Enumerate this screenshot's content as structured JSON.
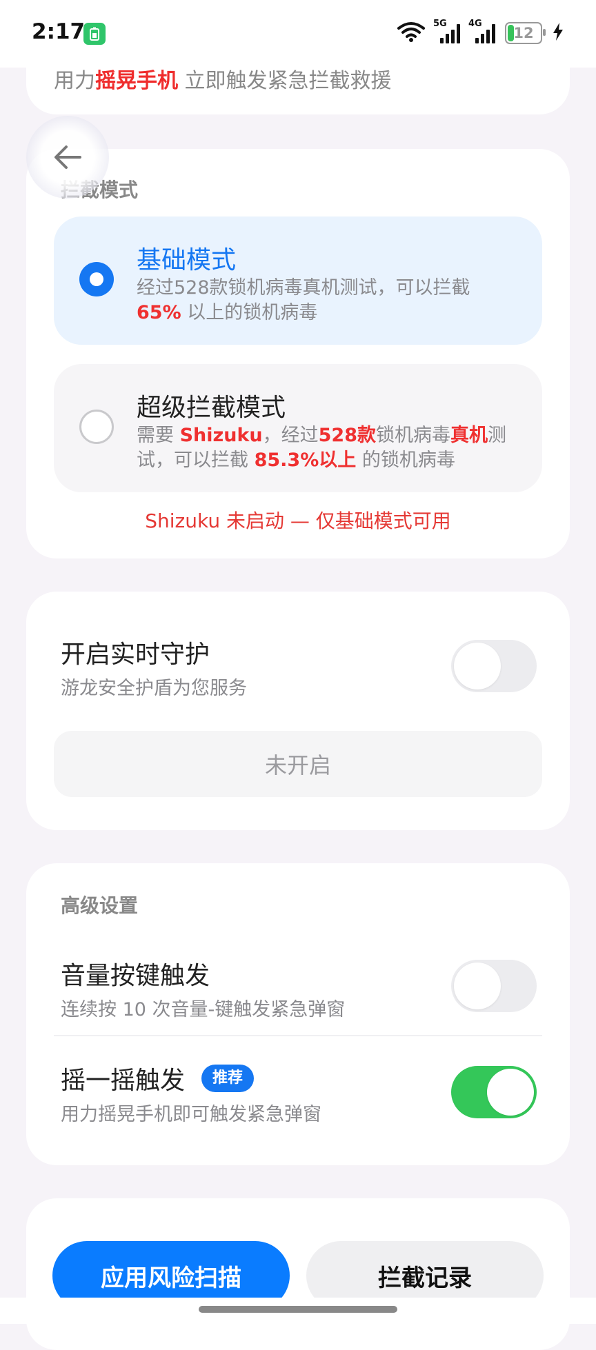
{
  "status_bar": {
    "time": "2:17",
    "battery": "12",
    "network_1": "5G",
    "network_2": "4G"
  },
  "top_card": {
    "prefix": "用力",
    "highlight": "摇晃手机",
    "suffix": " 立即触发紧急拦截救援"
  },
  "mode_section": {
    "title": "拦截模式",
    "basic": {
      "title": "基础模式",
      "desc_1": "经过528款锁机病毒真机测试，可以拦截 ",
      "desc_hl": "65%",
      "desc_2": " 以上的锁机病毒"
    },
    "super": {
      "title": "超级拦截模式",
      "d1": "需要 ",
      "d2": "Shizuku",
      "d3": "，经过",
      "d4": "528款",
      "d5": "锁机病毒",
      "d6": "真机",
      "d7": "测试，可以拦截 ",
      "d8": "85.3%以上",
      "d9": " 的锁机病毒"
    },
    "notice": "Shizuku 未启动 — 仅基础模式可用"
  },
  "guard_section": {
    "title": "开启实时守护",
    "subtitle": "游龙安全护盾为您服务",
    "enabled": false,
    "status": "未开启"
  },
  "advanced_section": {
    "title": "高级设置",
    "volume": {
      "title": "音量按键触发",
      "subtitle": "连续按 10 次音量-键触发紧急弹窗",
      "enabled": false
    },
    "shake": {
      "title": "摇一摇触发",
      "badge": "推荐",
      "subtitle": "用力摇晃手机即可触发紧急弹窗",
      "enabled": true
    }
  },
  "bottom_actions": {
    "primary": "应用风险扫描",
    "secondary": "拦截记录"
  },
  "colors": {
    "accent": "#1577f2",
    "danger": "#ef3030",
    "toggle_on": "#34c759"
  },
  "icons": {
    "back": "arrow-left-icon",
    "wifi": "wifi-icon",
    "charging": "bolt-icon"
  }
}
